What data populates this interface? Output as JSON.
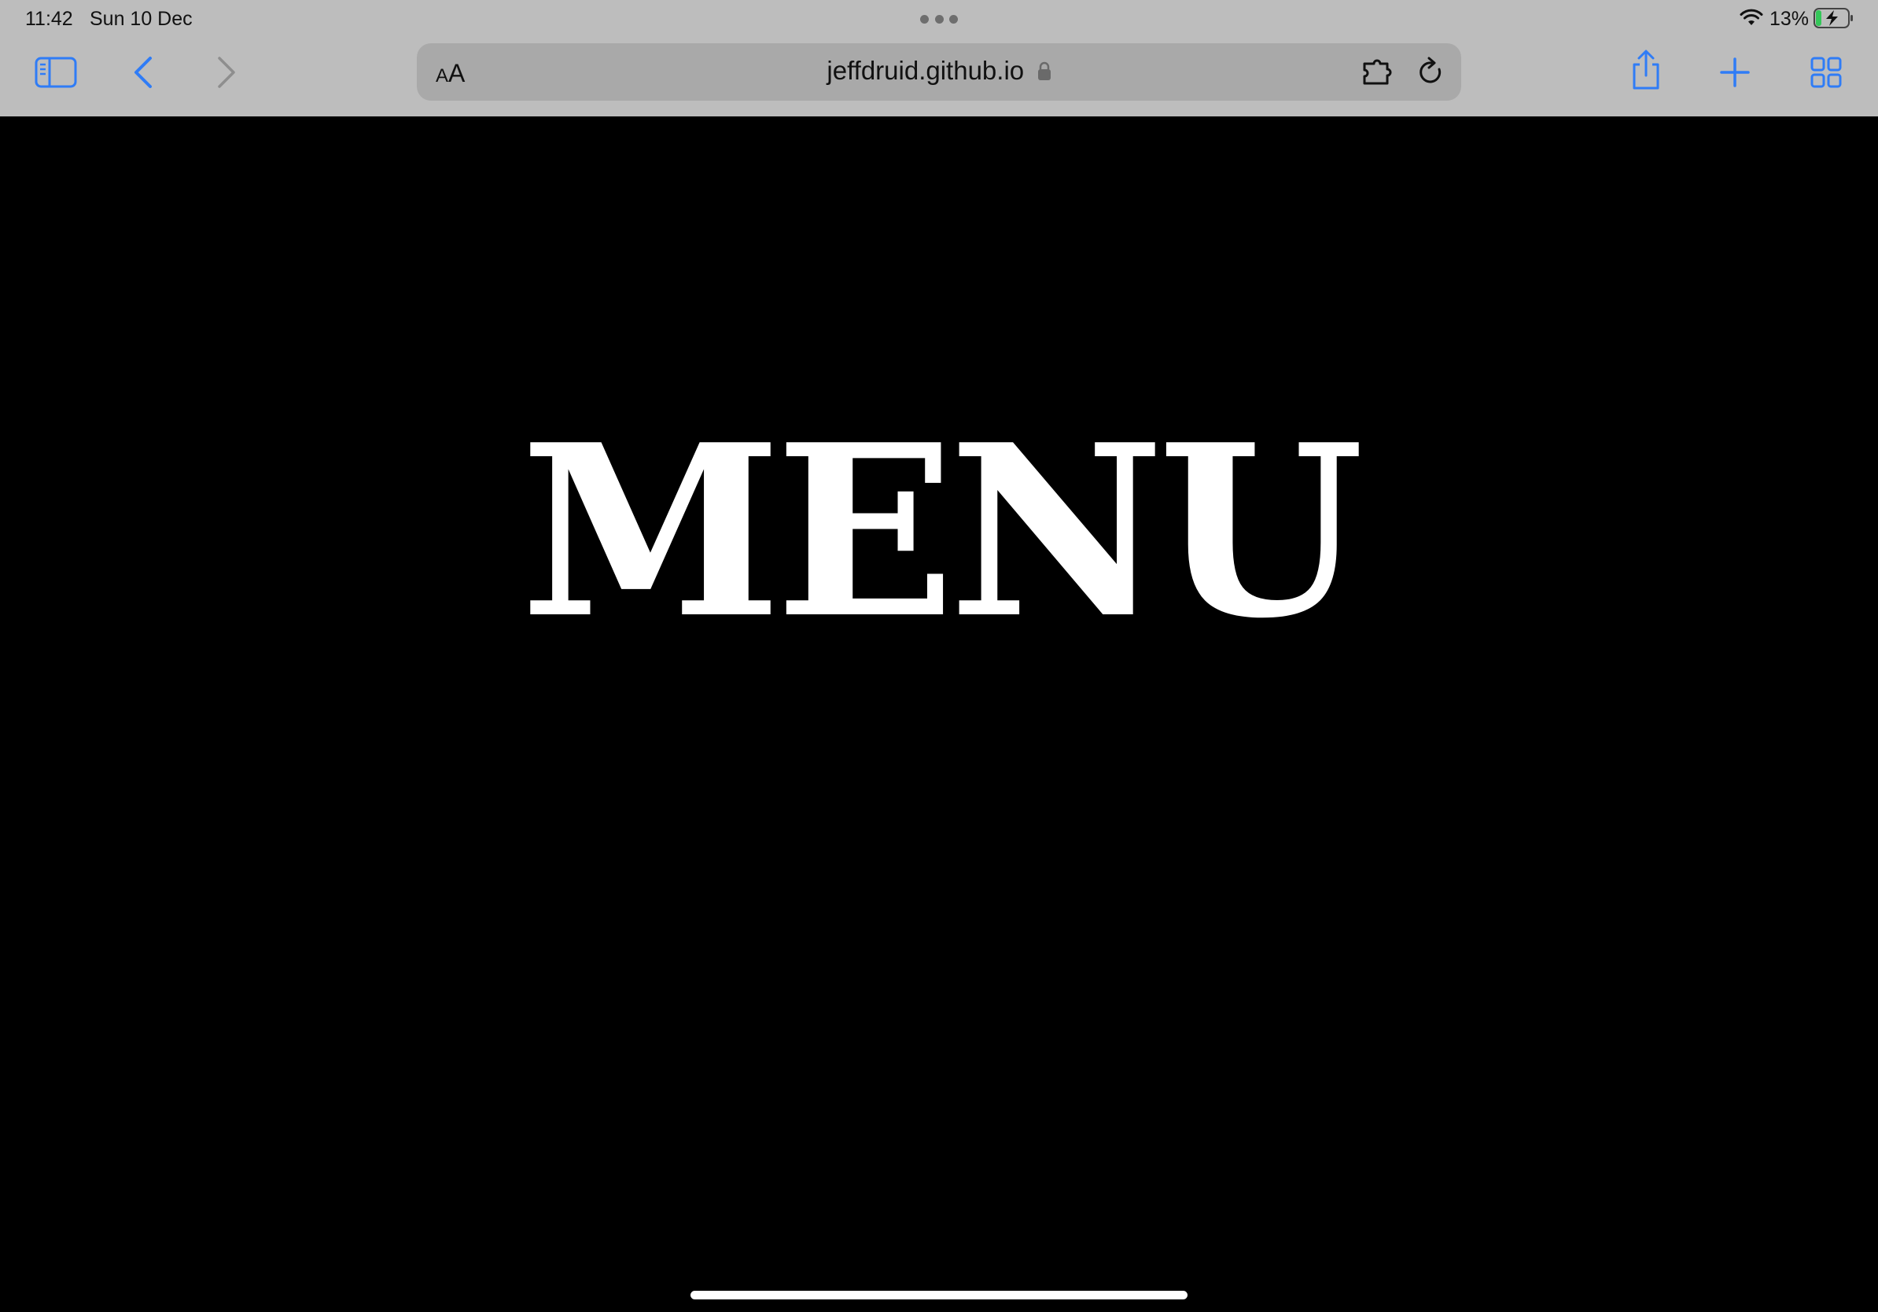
{
  "status_bar": {
    "time": "11:42",
    "date": "Sun 10 Dec",
    "battery_percent": "13%",
    "battery_level": 0.13,
    "charging": true
  },
  "browser": {
    "reader_text_small": "A",
    "reader_text_big": "A",
    "url": "jeffdruid.github.io",
    "secure": true,
    "icons": {
      "sidebar": "sidebar-icon",
      "back": "chevron-left-icon",
      "forward": "chevron-right-icon",
      "lock": "lock-icon",
      "extension": "extension-icon",
      "reload": "reload-icon",
      "share": "share-icon",
      "new_tab": "plus-icon",
      "tabs": "tab-grid-icon"
    },
    "colors": {
      "toolbar_bg": "#bdbdbd",
      "address_bg": "#a9a9a9",
      "accent": "#2f7cf6",
      "disabled": "#8e8e8e"
    }
  },
  "page": {
    "heading": "MENU",
    "background": "#000000",
    "text_color": "#ffffff"
  }
}
